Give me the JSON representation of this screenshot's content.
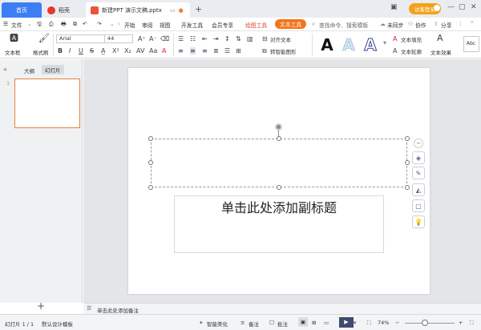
{
  "tabs": {
    "home": "首页",
    "docer": "稻壳",
    "document": "新建PPT 演示文稿.pptx",
    "new_tab": "+"
  },
  "login": "访客登录",
  "menu": {
    "file": "文件",
    "items": [
      "开始",
      "审阅",
      "视图",
      "开发工具",
      "会员专享"
    ],
    "draw_tools": "绘图工具",
    "text_tools": "文本工具",
    "search": "查找命令、搜索模板",
    "sync": "未同步",
    "collab": "协作",
    "share": "分享"
  },
  "ribbon": {
    "textbox": "文本框",
    "format_painter": "格式刷",
    "font_name": "Arial",
    "font_size": "44",
    "align_text": "对齐文本",
    "smart_shape": "转智能图形",
    "text_fill": "文本填充",
    "text_outline": "文本轮廓",
    "text_effect": "文本效果",
    "style_glyph": "A",
    "more_styles": "Abc"
  },
  "panel": {
    "outline_tab": "大纲",
    "slides_tab": "幻灯片",
    "slide_number": "1",
    "add": "+"
  },
  "slide": {
    "subtitle": "单击此处添加副标题"
  },
  "notes": "单击此处添加备注",
  "status": {
    "slide_count": "幻灯片 1 / 1",
    "template": "默认设计模板",
    "beautify": "智能美化",
    "notes": "备注",
    "comments": "批注",
    "zoom": "74%"
  },
  "colors": {
    "accent": "#3d7ef5",
    "orange": "#f2731b",
    "thumb_border": "#e8813c"
  }
}
